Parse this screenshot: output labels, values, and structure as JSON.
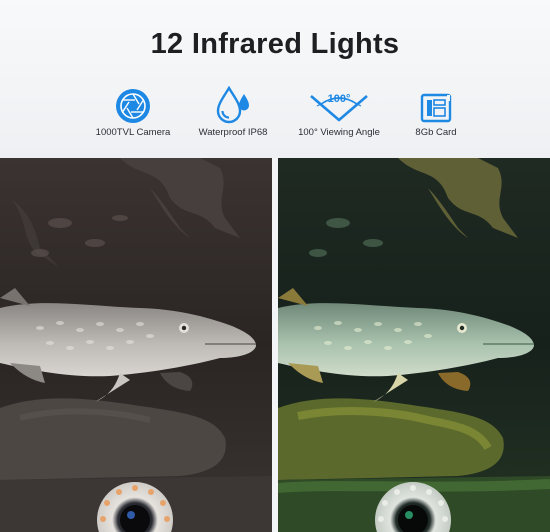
{
  "title": "12 Infrared Lights",
  "features": [
    {
      "icon": "camera-aperture-icon",
      "label": "1000TVL Camera"
    },
    {
      "icon": "water-drops-icon",
      "label": "Waterproof IP68"
    },
    {
      "icon": "viewing-angle-icon",
      "label": "100° Viewing Angle",
      "badge": "100°"
    },
    {
      "icon": "sd-card-icon",
      "label": "8Gb Card"
    }
  ],
  "colors": {
    "accent": "#1e88e5",
    "title": "#1d1f23",
    "background": "#f3f4f6"
  },
  "panels": [
    {
      "name": "left-photo",
      "mode": "infrared night view"
    },
    {
      "name": "right-photo",
      "mode": "color day view"
    }
  ]
}
